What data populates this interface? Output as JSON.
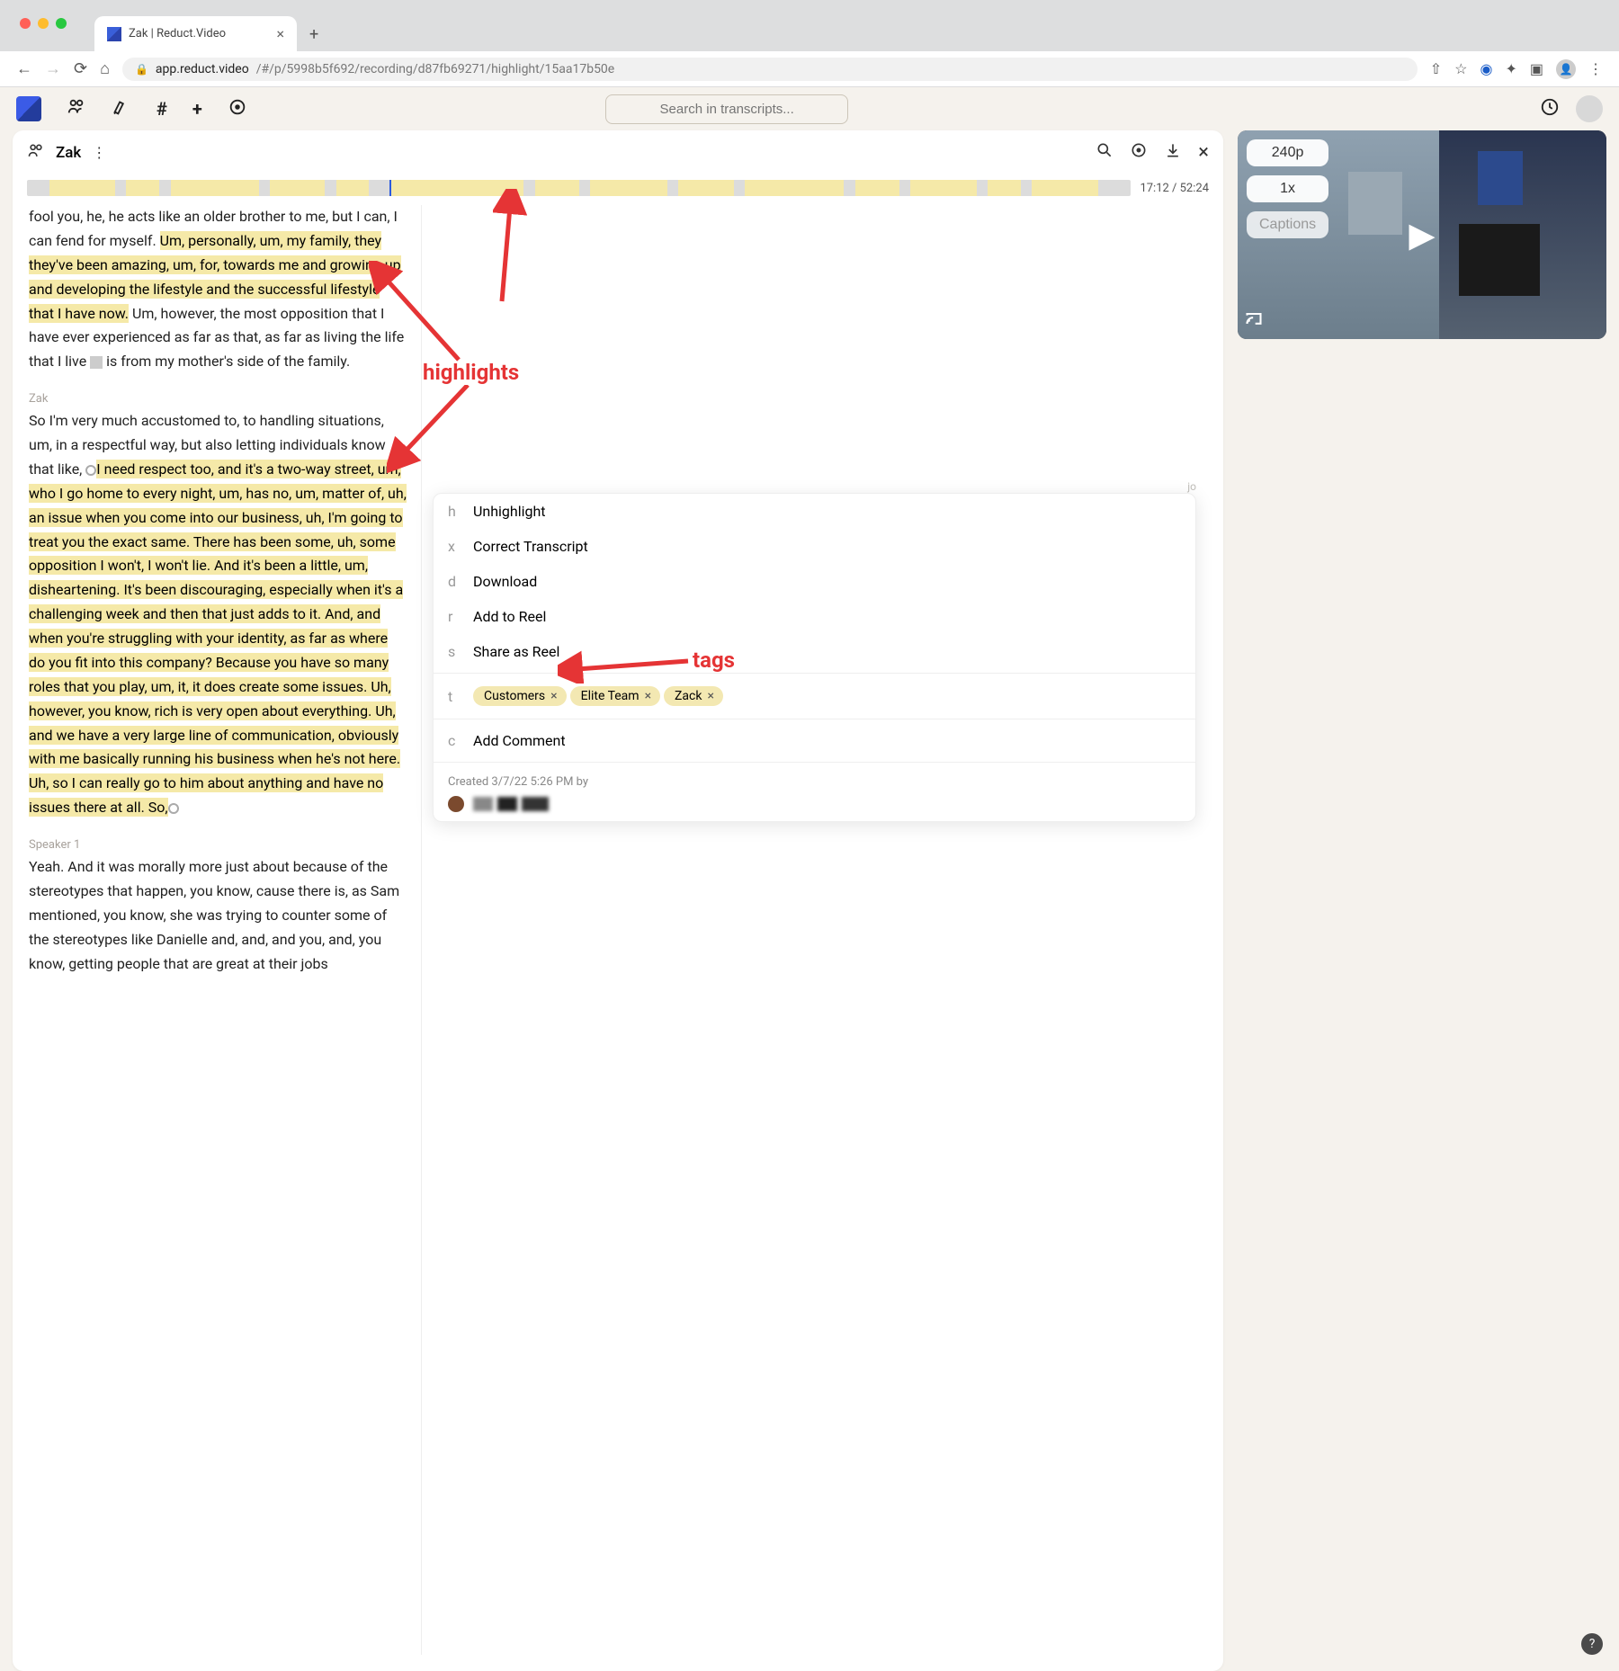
{
  "browser": {
    "tab_title": "Zak | Reduct.Video",
    "url_domain": "app.reduct.video",
    "url_path": "/#/p/5998b5f692/recording/d87fb69271/highlight/15aa17b50e"
  },
  "app": {
    "search_placeholder": "Search in transcripts..."
  },
  "doc": {
    "title": "Zak",
    "time": "17:12 / 52:24"
  },
  "transcript": {
    "p1_pre": "fool you, he, he acts like an older brother to me, but I can, I can fend for myself. ",
    "p1_hl": "Um, personally, um, my family, they they've been amazing, um, for, towards me and growing up and developing the lifestyle and the successful lifestyle that I have now.",
    "p1_post_a": " Um, however, the most opposition that I have ever experienced as far as that, as far as living the life that I live ",
    "p1_post_b": " is from my mother's side of the family.",
    "speaker2": "Zak",
    "p2_pre": "So I'm very much accustomed to, to handling situations, um, in a respectful way, but also letting individuals know that like, ",
    "p2_hl": "I need respect too, and it's a two-way street, um, who I go home to every night, um, has no, um, matter of, uh, an issue when you come into our business, uh, I'm going to treat you the exact same. There has been some, uh, some opposition I won't, I won't lie. And it's been a little, um, disheartening. It's been discouraging, especially when it's a challenging week and then that just adds to it. And, and when you're struggling with your identity, as far as where do you fit into this company? Because you have so many roles that you play, um, it, it does create some issues. Uh, however, you know, rich is very open about everything. Uh, and we have a very large line of communication, obviously with me basically running his business when he's not here. Uh, so I can really go to him about anything and have no issues there at all. So,",
    "speaker3": "Speaker 1",
    "p3": "Yeah. And it was morally more just about because of the stereotypes that happen, you know, cause there is, as Sam mentioned, you know, she was trying to counter some of the stereotypes like Danielle and, and, and you, and, you know, getting people that are great at their jobs"
  },
  "popup": {
    "items": [
      {
        "key": "h",
        "label": "Unhighlight"
      },
      {
        "key": "x",
        "label": "Correct Transcript"
      },
      {
        "key": "d",
        "label": "Download"
      },
      {
        "key": "r",
        "label": "Add to Reel"
      },
      {
        "key": "s",
        "label": "Share as Reel"
      }
    ],
    "tags_key": "t",
    "tags": [
      "Customers",
      "Elite Team",
      "Zack"
    ],
    "comment_key": "c",
    "comment_label": "Add Comment",
    "created": "Created 3/7/22 5:26 PM by",
    "float_ts_suffix": "jo"
  },
  "video": {
    "quality": "240p",
    "speed": "1x",
    "captions": "Captions"
  },
  "callouts": {
    "highlights": "highlights",
    "tags": "tags"
  },
  "help": "?"
}
